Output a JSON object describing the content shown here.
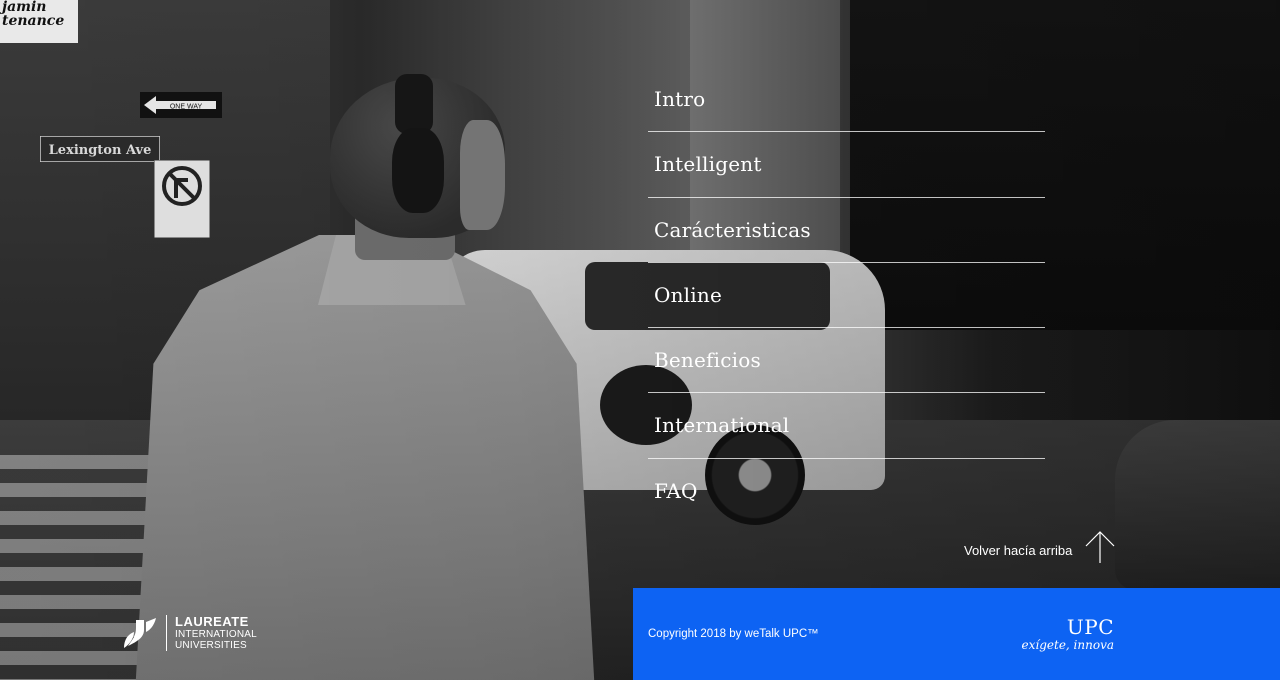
{
  "background": {
    "street_sign_text": "Lexington Ave",
    "one_way_sign_text": "ONE WAY",
    "top_sign_lines": [
      "jamin",
      "tenance"
    ]
  },
  "nav": {
    "items": [
      {
        "label": "Intro"
      },
      {
        "label": "Intelligent"
      },
      {
        "label": "Carácteristicas"
      },
      {
        "label": "Online"
      },
      {
        "label": "Beneficios"
      },
      {
        "label": "International"
      },
      {
        "label": "FAQ"
      }
    ]
  },
  "back_to_top": {
    "label": "Volver hacía arriba",
    "icon": "arrow-up-icon"
  },
  "laureate_logo": {
    "line1": "LAUREATE",
    "line2": "INTERNATIONAL",
    "line3": "UNIVERSITIES"
  },
  "footer": {
    "copyright": "Copyright 2018 by weTalk UPC™",
    "brand": "UPC",
    "tagline": "exígete, innova",
    "color": "#0d63f3"
  }
}
